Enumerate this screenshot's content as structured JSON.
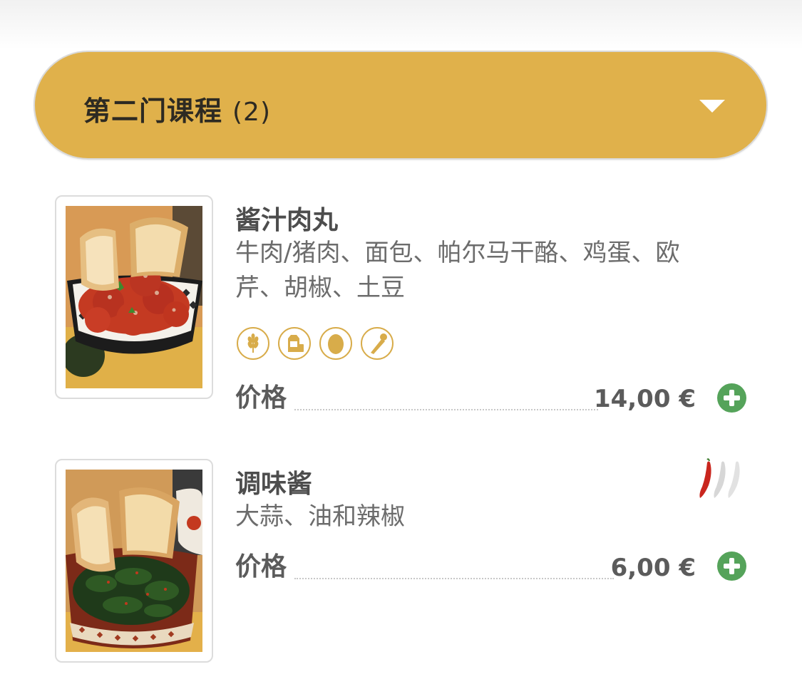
{
  "section": {
    "title": "第二门课程",
    "count": "(2)",
    "header_color": "#e0b14b"
  },
  "items": [
    {
      "name": "酱汁肉丸",
      "description": "牛肉/猪肉、面包、帕尔马干酪、鸡蛋、欧芹、胡椒、土豆",
      "image_icon": "meatballs-photo",
      "allergens": [
        "wheat-gluten-icon",
        "milk-dairy-icon",
        "egg-icon",
        "celery-icon"
      ],
      "price_label": "价格",
      "price": "14,00 €",
      "add_icon": "plus-circle-icon"
    },
    {
      "name": "调味酱",
      "description": "大蒜、油和辣椒",
      "image_icon": "greens-with-bread-photo",
      "spice_level": 1,
      "spice_max": 3,
      "price_label": "价格",
      "price": "6,00 €",
      "add_icon": "plus-circle-icon"
    }
  ],
  "colors": {
    "allergen_gold": "#d8ac4a",
    "add_green": "#55a35a",
    "chili_red": "#c9261e"
  }
}
